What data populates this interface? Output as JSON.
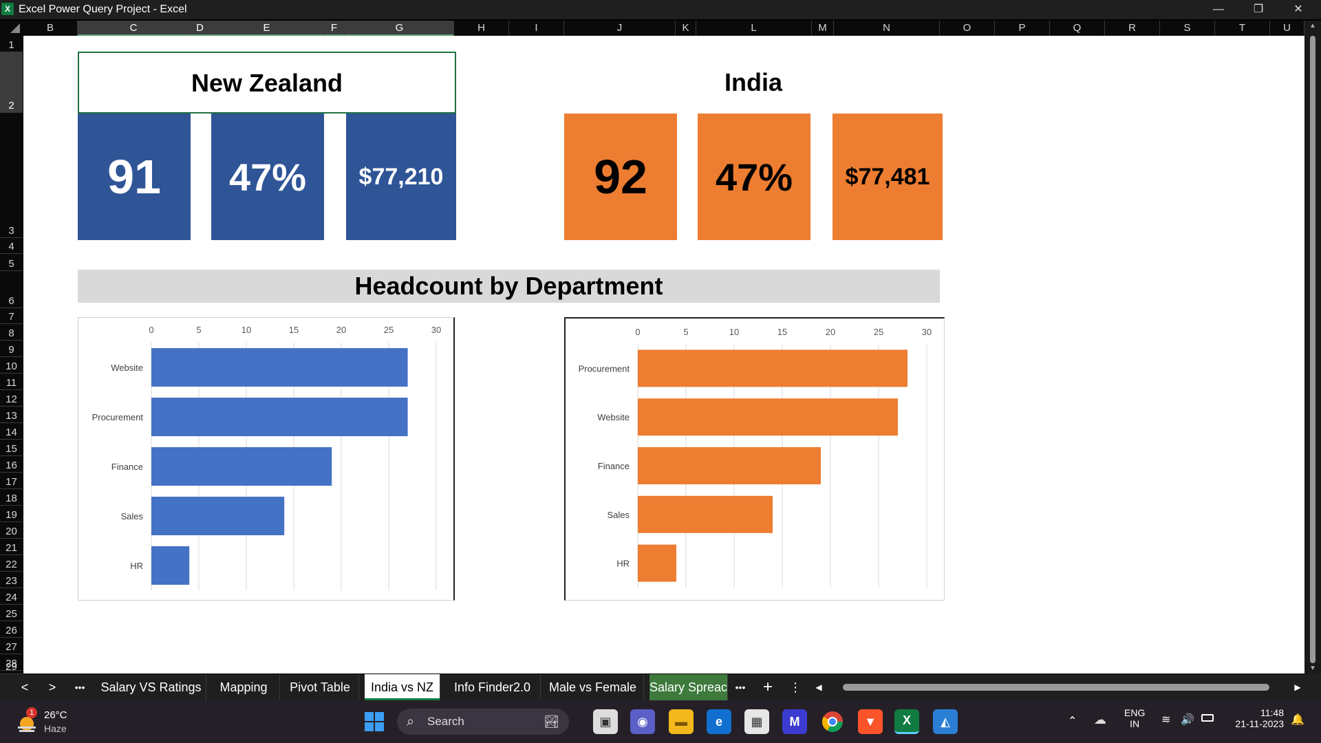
{
  "window": {
    "title": "Excel Power Query Project - Excel",
    "app_icon": "X",
    "controls": {
      "minimize": "—",
      "restore": "❐",
      "close": "✕"
    }
  },
  "columns": [
    "B",
    "C",
    "D",
    "E",
    "F",
    "G",
    "H",
    "I",
    "J",
    "K",
    "L",
    "M",
    "N",
    "O",
    "P",
    "Q",
    "R",
    "S",
    "T",
    "U"
  ],
  "rows": [
    "1",
    "2",
    "3",
    "4",
    "5",
    "6",
    "7",
    "8",
    "9",
    "10",
    "11",
    "12",
    "13",
    "14",
    "15",
    "16",
    "17",
    "18",
    "19",
    "20",
    "21",
    "22",
    "23",
    "24",
    "25",
    "26",
    "27",
    "28",
    "29"
  ],
  "nz": {
    "title": "New Zealand",
    "kpis": [
      "91",
      "47%",
      "$77,210"
    ],
    "color": "#2f5597"
  },
  "india": {
    "title": "India",
    "kpis": [
      "92",
      "47%",
      "$77,481"
    ],
    "color": "#ed7d31"
  },
  "banner": {
    "title": "Headcount by Department"
  },
  "chart_data": [
    {
      "type": "bar",
      "orientation": "horizontal",
      "categories": [
        "Website",
        "Procurement",
        "Finance",
        "Sales",
        "HR"
      ],
      "values": [
        27,
        27,
        19,
        14,
        4
      ],
      "xlim": [
        0,
        30
      ],
      "ticks": [
        "0",
        "5",
        "10",
        "15",
        "20",
        "25",
        "30"
      ],
      "grid": true,
      "color": "#4472c4"
    },
    {
      "type": "bar",
      "orientation": "horizontal",
      "categories": [
        "Procurement",
        "Website",
        "Finance",
        "Sales",
        "HR"
      ],
      "values": [
        28,
        27,
        19,
        14,
        4
      ],
      "xlim": [
        0,
        30
      ],
      "ticks": [
        "0",
        "5",
        "10",
        "15",
        "20",
        "25",
        "30"
      ],
      "grid": true,
      "color": "#ed7d31"
    }
  ],
  "sheet_tabs": {
    "nav_prev": "<",
    "nav_next": ">",
    "more": "•••",
    "tabs": [
      "Salary VS Ratings",
      "Mapping",
      "Pivot Table",
      "India vs NZ",
      "Info Finder2.0",
      "Male vs Female",
      "Salary Spreac"
    ],
    "active": "India vs NZ",
    "more_after": "•••",
    "add": "+",
    "options": "⋮"
  },
  "taskbar": {
    "weather_temp": "26°C",
    "weather_desc": "Haze",
    "weather_badge": "1",
    "search_label": "Search",
    "lang_top": "ENG",
    "lang_bottom": "IN",
    "time": "11:48",
    "date": "21-11-2023"
  }
}
